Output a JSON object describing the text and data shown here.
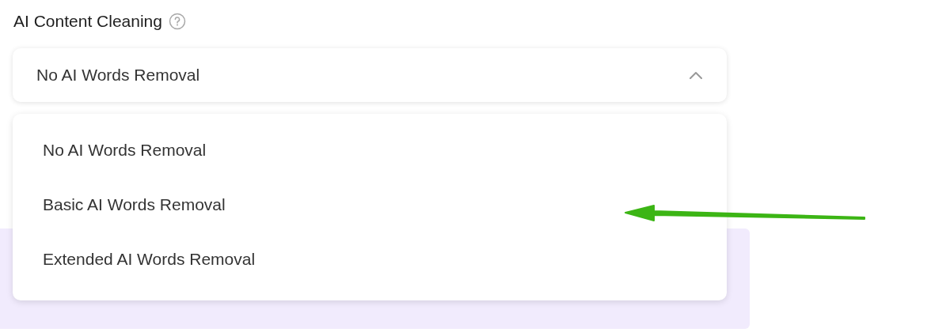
{
  "section": {
    "title": "AI Content Cleaning"
  },
  "select": {
    "value": "No AI Words Removal",
    "expanded": true
  },
  "options": [
    {
      "label": "No AI Words Removal"
    },
    {
      "label": "Basic AI Words Removal"
    },
    {
      "label": "Extended AI Words Removal"
    }
  ]
}
